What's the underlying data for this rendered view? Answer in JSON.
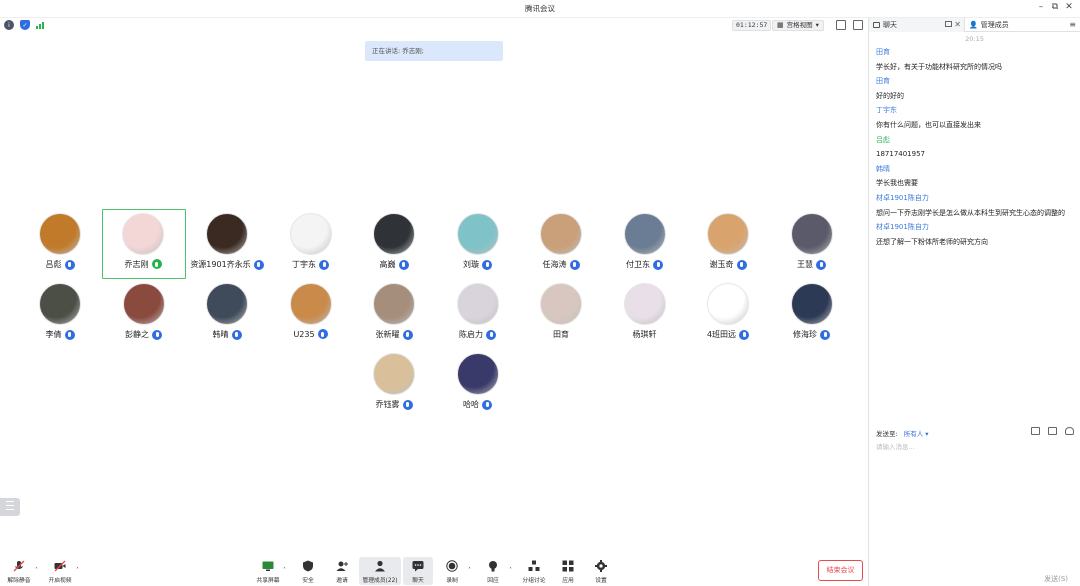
{
  "window": {
    "title": "腾讯会议"
  },
  "top": {
    "timer": "01:12:57",
    "view_label": "宫格视图"
  },
  "speaking": {
    "text": "正在讲话: 乔志刚;"
  },
  "participants": [
    {
      "name": "吕彪",
      "avatar_color": "#c07a2a",
      "mic": "blue"
    },
    {
      "name": "乔志刚",
      "avatar_color": "#f3d6d6",
      "mic": "green"
    },
    {
      "name": "资源1901齐永乐",
      "avatar_color": "#3a2a22",
      "mic": "blue"
    },
    {
      "name": "丁宇东",
      "avatar_color": "#f4f4f4",
      "mic": "blue"
    },
    {
      "name": "高巍",
      "avatar_color": "#2f3338",
      "mic": "blue"
    },
    {
      "name": "刘璇",
      "avatar_color": "#7fc3c9",
      "mic": "blue"
    },
    {
      "name": "任海涛",
      "avatar_color": "#c9a07a",
      "mic": "blue"
    },
    {
      "name": "付卫东",
      "avatar_color": "#6b7d94",
      "mic": "blue"
    },
    {
      "name": "谢玉奇",
      "avatar_color": "#d9a36e",
      "mic": "blue"
    },
    {
      "name": "王慧",
      "avatar_color": "#5a5a6a",
      "mic": "blue"
    },
    {
      "name": "李倩",
      "avatar_color": "#4b4f46",
      "mic": "blue"
    },
    {
      "name": "彭静之",
      "avatar_color": "#8a4a3e",
      "mic": "blue"
    },
    {
      "name": "韩晴",
      "avatar_color": "#3f4a5a",
      "mic": "blue"
    },
    {
      "name": "U235",
      "avatar_color": "#c98a4a",
      "mic": "blue"
    },
    {
      "name": "张新曜",
      "avatar_color": "#a58e7c",
      "mic": "blue"
    },
    {
      "name": "陈启力",
      "avatar_color": "#d9d4dc",
      "mic": "blue"
    },
    {
      "name": "田育",
      "avatar_color": "#d8c7c0",
      "mic": "none"
    },
    {
      "name": "杨琪轩",
      "avatar_color": "#e8dfe8",
      "mic": "none"
    },
    {
      "name": "4班田远",
      "avatar_color": "#ffffff",
      "mic": "blue"
    },
    {
      "name": "修海珍",
      "avatar_color": "#2d3a55",
      "mic": "blue"
    },
    {
      "name": "乔钰雾",
      "avatar_color": "#d9c09a",
      "mic": "blue"
    },
    {
      "name": "哈哈",
      "avatar_color": "#3a3a6a",
      "mic": "blue"
    }
  ],
  "sidebar": {
    "tab_chat": "聊天",
    "tab_manage": "管理成员",
    "time": "20:15",
    "messages": [
      {
        "sender": "田育",
        "text": "学长好，有关于功能材料研究所的情况吗",
        "color": "#3b7ae0"
      },
      {
        "sender": "田育",
        "text": "好的好的",
        "color": "#3b7ae0"
      },
      {
        "sender": "丁宇东",
        "text": "你有什么问题，也可以直接发出来",
        "color": "#3b7ae0"
      },
      {
        "sender": "吕彪",
        "text": "18717401957",
        "color": "#2fb05a"
      },
      {
        "sender": "韩晴",
        "text": "学长我也需要",
        "color": "#3b7ae0"
      },
      {
        "sender": "材卓1901陈自力",
        "text": "想问一下乔志刚学长是怎么做从本科生到研究生心态的调整的",
        "color": "#3b7ae0"
      },
      {
        "sender": "材卓1901陈自力",
        "text": "还想了解一下粉体所老师的研究方向",
        "color": "#3b7ae0"
      }
    ],
    "send_to_label": "发送至:",
    "send_to_value": "所有人 ▾",
    "input_placeholder": "请输入消息...",
    "send_button": "发送(S)"
  },
  "toolbar": {
    "mute": "解除静音",
    "video": "开启视频",
    "share": "共享屏幕",
    "security": "安全",
    "invite": "邀请",
    "members": "管理成员(22)",
    "chat": "聊天",
    "record": "录制",
    "reaction": "回应",
    "breakout": "分组讨论",
    "apps": "应用",
    "settings": "设置",
    "end": "结束会议"
  }
}
